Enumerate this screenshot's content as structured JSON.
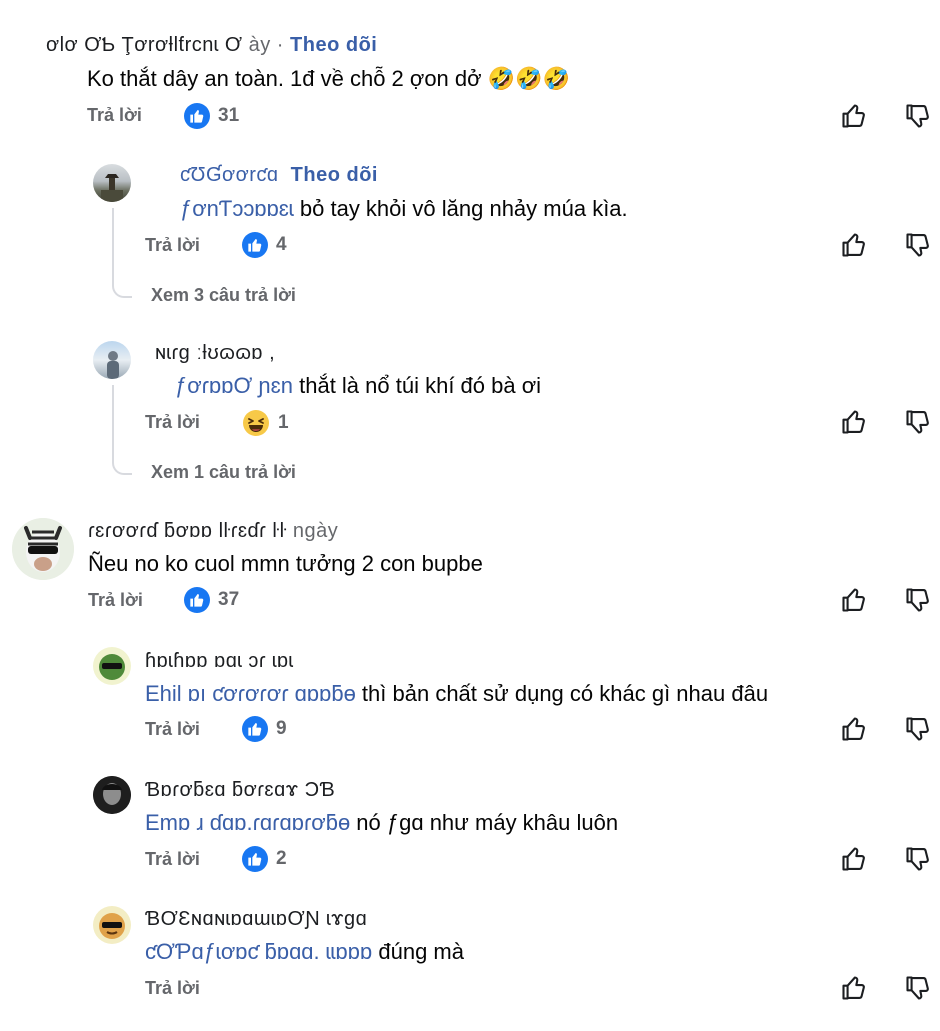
{
  "comments": [
    {
      "name": "ơlơ ƠƄ Ţơrơƚlƭrcnɩ Ơ",
      "time": "ày",
      "follow": "Theo dõi",
      "text": "Ko thắt dây an toàn. 1đ về chỗ 2 ợon dở",
      "emojis": "🤣🤣🤣",
      "reply": "Trả lời",
      "count": "31"
    },
    {
      "name": "ƈƱƓơơrƈɑ",
      "follow": "Theo dõi",
      "mention": "ƒơnƬɔɔɒɒɛɩ",
      "text": " bỏ tay khỏi vô lăng nhảy múa kìa.",
      "reply": "Trả lời",
      "count": "4",
      "view_more": "Xem 3 câu trả lời"
    },
    {
      "name": "ɴɩɾɡ ːƚʊɷɷɒ ,",
      "mention": "ƒơɾɒɒƠ ɲɛn",
      "text": " thắt là nổ túi khí đó bà ơi",
      "reply": "Trả lời",
      "count": "1",
      "view_more": "Xem 1 câu trả lời"
    },
    {
      "name": "ɾɛɾơơɾɗ ƃơɒɒ   Ɩŀɾɛɗɾ   ŀŀ",
      "time": "ngày",
      "text": "Ñeu no ko cuol mmn tưởng 2 con bupbe",
      "reply": "Trả lời",
      "count": "37"
    },
    {
      "name": "ɦɒɩɦɒɒ ɒɑɩ  ɔɾ  ɩɒɩ",
      "mention": "Ehil ɒı ƈơɾơɾơɾ ɑɒɒƃɵ",
      "text": " thì bản chất sử dụng có khác gì nhau đâu",
      "reply": "Trả lời",
      "count": "9"
    },
    {
      "name": "Ɓɒɾơƃɛɑ  ƃơɾɛɑɤ ƆƁ",
      "mention": "Emɒ  ɹ ɗɑɒ.ɾɑɾɑɒɾơƃɵ",
      "text": " nó ƒɡɑ như máy khâu luôn",
      "reply": "Trả lời",
      "count": "2"
    },
    {
      "name": "ƁƠƐɴɑɴɩɒɑɯɩɒƠƝ  ɩɤɡɑ",
      "mention": "ƈƠƤɑƒɩơɒƈ ƃɒɑɑ. ɩɩɒɒɒ",
      "text": " đúng mà",
      "reply": "Trả lời"
    }
  ],
  "icons": {
    "like": "thumbs-up-outline-icon",
    "dislike": "thumbs-down-outline-icon",
    "like_badge": "like-reaction-badge",
    "haha_badge": "haha-reaction-badge"
  },
  "colors": {
    "link": "#3a5fa8",
    "secondary_text": "#65676b",
    "like_blue": "#1877f2"
  }
}
